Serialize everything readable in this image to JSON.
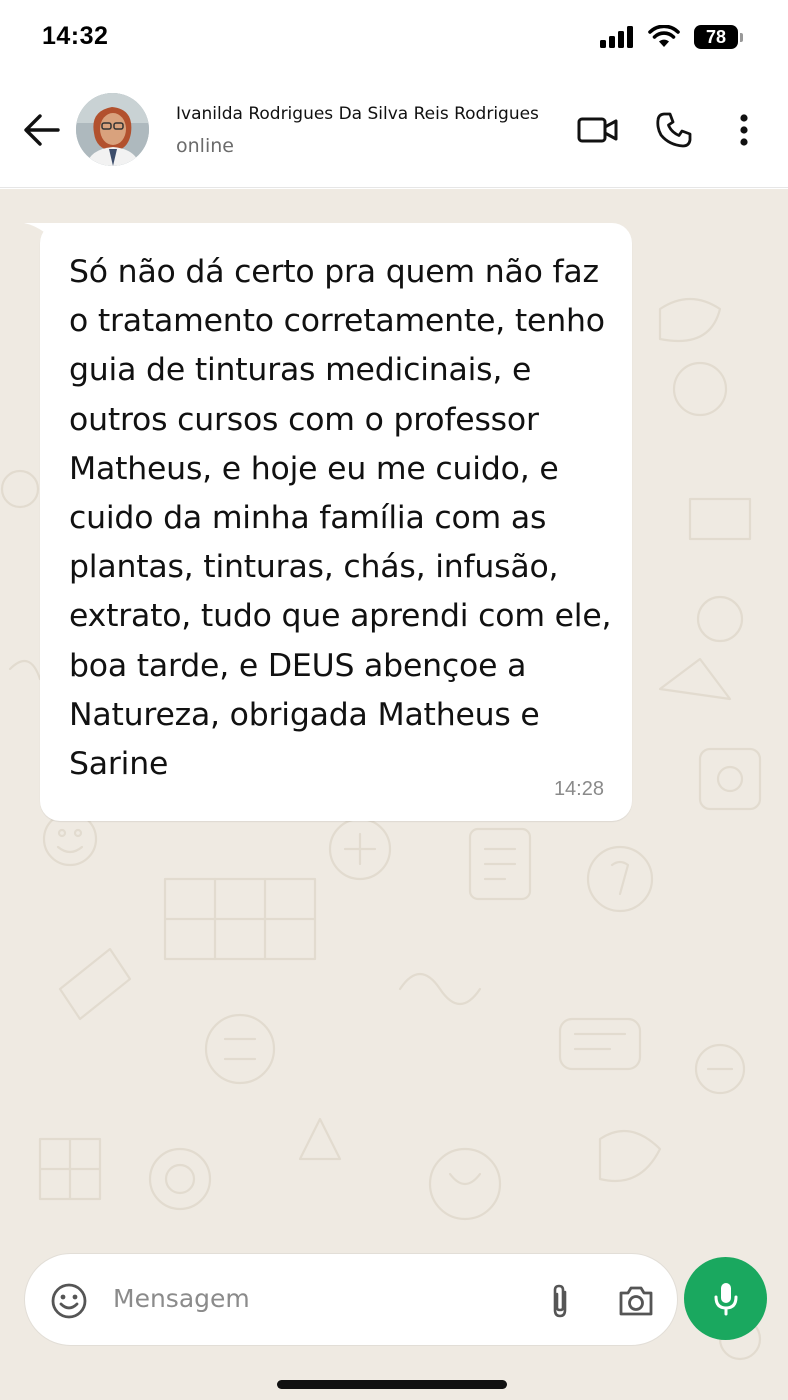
{
  "status_bar": {
    "time": "14:32",
    "battery_level": "78",
    "icons": [
      "signal-icon",
      "wifi-icon",
      "battery-icon"
    ]
  },
  "header": {
    "contact_name": "Ivanilda Rodrigues Da Silva Reis Rodrigues",
    "contact_status": "online",
    "icons": [
      "back-arrow-icon",
      "video-call-icon",
      "voice-call-icon",
      "more-options-icon"
    ]
  },
  "conversation": {
    "messages": [
      {
        "direction": "incoming",
        "text": "Só não dá certo pra quem não faz o tratamento corretamente, tenho guia de tinturas medicinais, e outros cursos com o professor Matheus, e hoje eu me cuido, e cuido da minha família com as plantas, tinturas, chás, infusão, extrato, tudo que aprendi com ele, boa tarde, e DEUS abençoe a Natureza, obrigada Matheus e Sarine",
        "time": "14:28"
      }
    ]
  },
  "composer": {
    "placeholder": "Mensagem",
    "icons": [
      "emoji-icon",
      "attach-icon",
      "camera-icon",
      "microphone-icon"
    ]
  },
  "colors": {
    "chat_background": "#efeae2",
    "bubble": "#ffffff",
    "accent_green": "#1aa85f",
    "secondary_text": "#6b6b6b"
  }
}
